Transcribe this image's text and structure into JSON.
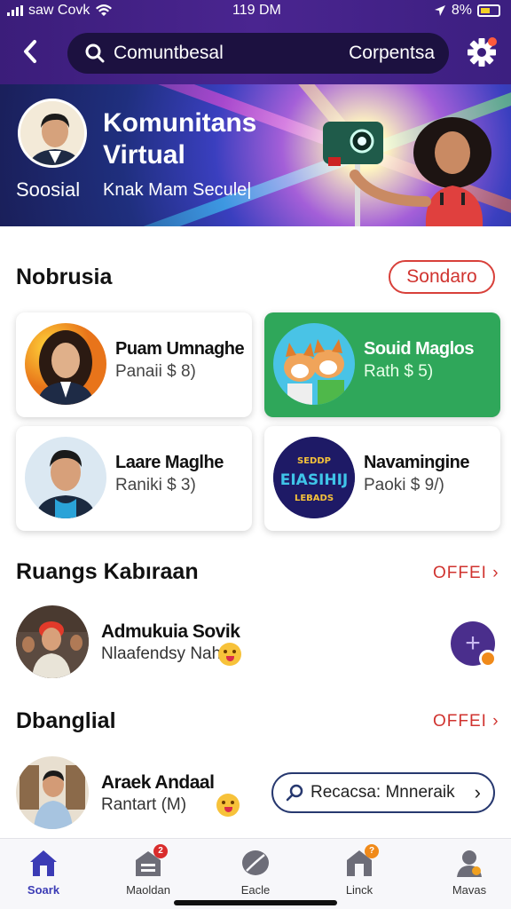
{
  "status_bar": {
    "carrier": "saw Covk",
    "time": "119 DM",
    "battery": "8%"
  },
  "header": {
    "search_query": "Comuntbesal",
    "search_right_label": "Corpentsa"
  },
  "banner": {
    "title": "Komunitans Virtual",
    "subtitle_left": "Soosial",
    "subtitle_right": "Knak Mam Secule|"
  },
  "section1": {
    "title": "Nobrusia",
    "action_label": "Sondaro",
    "cards": [
      {
        "name": "Puam Umnaghe",
        "price": "Panaii $ 8)"
      },
      {
        "name": "Souid Maglos",
        "price": "Rath $ 5)"
      },
      {
        "name": "Laare Maglhe",
        "price": "Raniki $ 3)"
      },
      {
        "name": "Navamingine",
        "price": "Paoki $ 9/)"
      }
    ],
    "card4_logo_text": [
      "SEDDP",
      "EIASIHIJ",
      "LEBADS"
    ]
  },
  "section2": {
    "title": "Ruangs Kabıraan",
    "more_label": "OFFEI",
    "row": {
      "name": "Admukuia Sovik",
      "sub": "Nlaafendsy Nahin"
    }
  },
  "section3": {
    "title": "Dbanglial",
    "more_label": "OFFEI",
    "row": {
      "name": "Araek Andaal",
      "sub": "Rantart (M)"
    }
  },
  "floating_search": {
    "label": "Recacsa: Mnneraik"
  },
  "bottom_nav": {
    "items": [
      {
        "label": "Soark",
        "icon": "home-icon",
        "active": true
      },
      {
        "label": "Maoldan",
        "icon": "store-icon",
        "badge": "2"
      },
      {
        "label": "Eacle",
        "icon": "leaf-icon"
      },
      {
        "label": "Linck",
        "icon": "house-icon",
        "badge": "?"
      },
      {
        "label": "Mavas",
        "icon": "profile-icon"
      }
    ]
  },
  "colors": {
    "header_bg": "#3b1d7a",
    "accent_red": "#d0332f",
    "card_green": "#2fa75a",
    "nav_active": "#3b3bb5"
  }
}
